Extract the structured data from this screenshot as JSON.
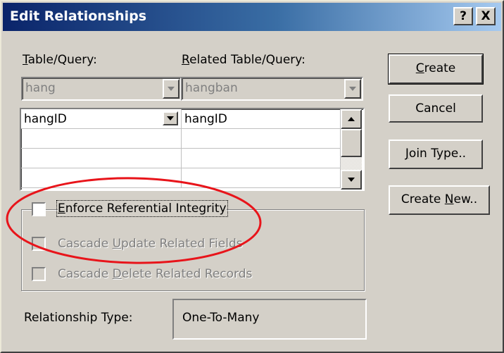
{
  "window": {
    "title": "Edit Relationships"
  },
  "titlebar_buttons": {
    "help": "?",
    "close": "X"
  },
  "labels": {
    "table_query_prefix": "T",
    "table_query_rest": "able/Query:",
    "related_prefix": "R",
    "related_rest": "elated Table/Query:"
  },
  "table_combo": {
    "value": "hang"
  },
  "related_combo": {
    "value": "hangban"
  },
  "field_grid": {
    "rows": [
      {
        "left": "hangID",
        "right": "hangID"
      },
      {
        "left": "",
        "right": ""
      },
      {
        "left": "",
        "right": ""
      },
      {
        "left": "",
        "right": ""
      }
    ]
  },
  "buttons": {
    "create_u": "C",
    "create_rest": "reate",
    "cancel": "Cancel",
    "join_u": "J",
    "join_rest": "oin Type..",
    "create_new_pre": "Create ",
    "create_new_u": "N",
    "create_new_rest": "ew.."
  },
  "options": {
    "enforce_u": "E",
    "enforce_rest": "nforce Referential Integrity",
    "cascade_update_pre": "Cascade ",
    "cascade_update_u": "U",
    "cascade_update_rest": "pdate Related Fields",
    "cascade_delete_pre": "Cascade ",
    "cascade_delete_u": "D",
    "cascade_delete_rest": "elete Related Records"
  },
  "relationship_type": {
    "label": "Relationship Type:",
    "value": "One-To-Many"
  },
  "colors": {
    "annotation": "#e8141a",
    "title_bg": "#0a246a"
  }
}
